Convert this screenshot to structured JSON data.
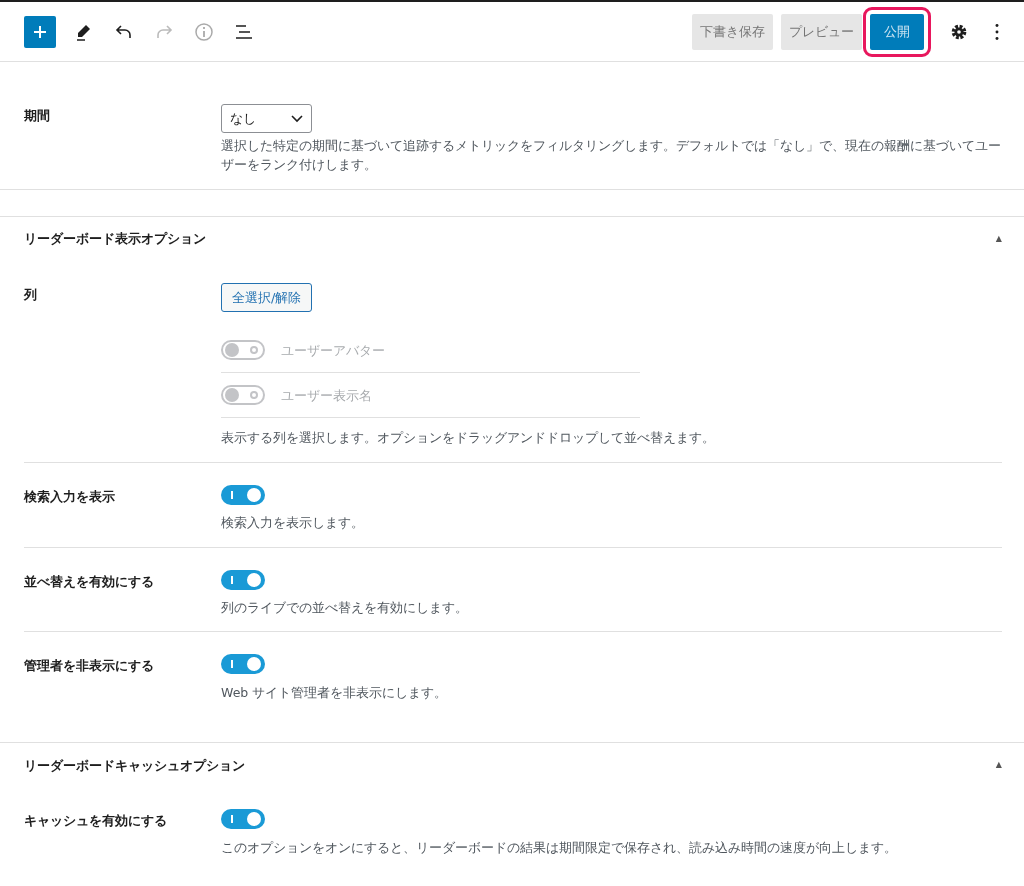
{
  "toolbar": {
    "buttons": [
      {
        "label": "下書き保存",
        "kind": "draft"
      },
      {
        "label": "プレビュー",
        "kind": "preview"
      },
      {
        "label": "公開",
        "kind": "publish",
        "highlighted": true
      }
    ]
  },
  "sections": [
    {
      "rows": [
        {
          "kind": "select",
          "label": "期間",
          "value": "なし",
          "help": "選択した特定の期間に基づいて追跡するメトリックをフィルタリングします。デフォルトでは「なし」で、現在の報酬に基づいてユーザーをランク付けします。"
        }
      ]
    },
    {
      "title": "リーダーボード表示オプション",
      "caret": "▲",
      "rows": [
        {
          "kind": "columns",
          "label": "列",
          "button": "全選択/解除",
          "options": [
            {
              "label": "ユーザーアバター",
              "on": false
            },
            {
              "label": "ユーザー表示名",
              "on": false
            }
          ],
          "help": "表示する列を選択します。オプションをドラッグアンドドロップして並べ替えます。"
        },
        {
          "kind": "toggle",
          "label": "検索入力を表示",
          "on": true,
          "help": "検索入力を表示します。"
        },
        {
          "kind": "toggle",
          "label": "並べ替えを有効にする",
          "on": true,
          "help": "列のライブでの並べ替えを有効にします。"
        },
        {
          "kind": "toggle",
          "label": "管理者を非表示にする",
          "on": true,
          "help": "Web サイト管理者を非表示にします。"
        }
      ]
    },
    {
      "title": "リーダーボードキャッシュオプション",
      "caret": "▲",
      "rows": [
        {
          "kind": "toggle",
          "label": "キャッシュを有効にする",
          "on": true,
          "help": "このオプションをオンにすると、リーダーボードの結果は期間限定で保存され、読み込み時間の速度が向上します。"
        }
      ]
    }
  ]
}
